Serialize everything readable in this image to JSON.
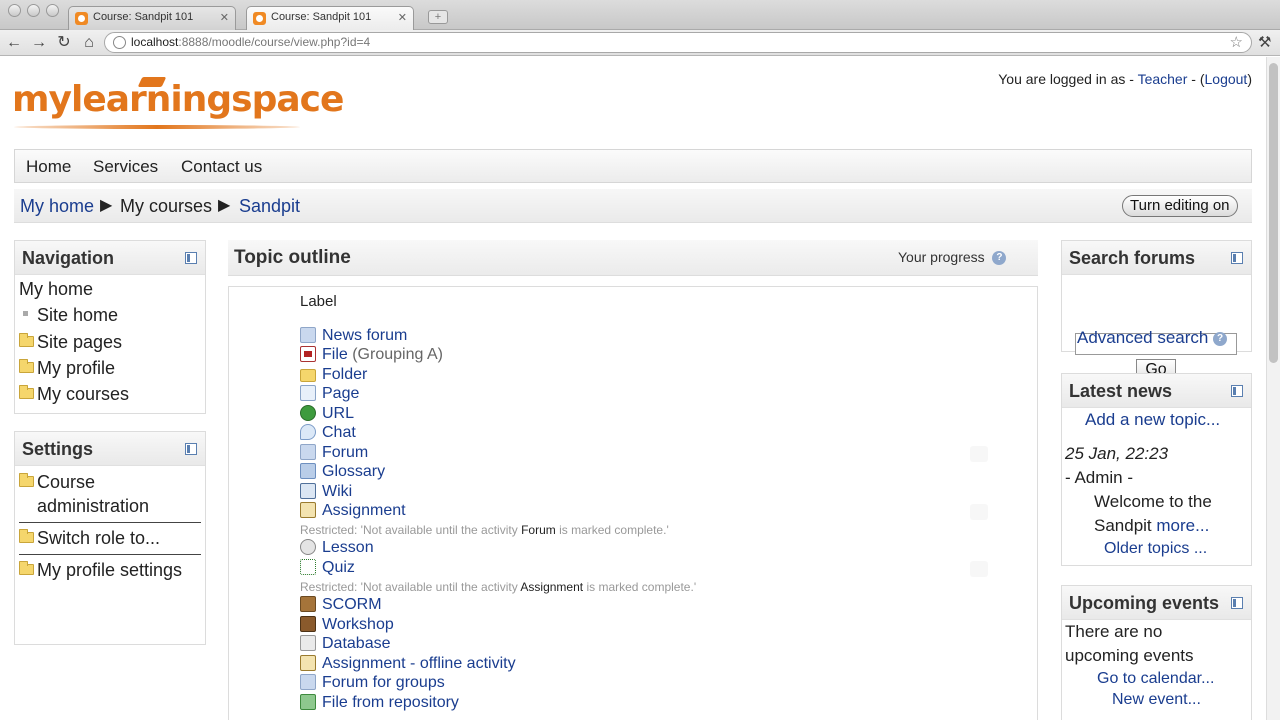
{
  "browser": {
    "tabs": [
      {
        "title": "Course: Sandpit 101",
        "active": false
      },
      {
        "title": "Course: Sandpit 101",
        "active": true
      }
    ],
    "url_host": "localhost",
    "url_path": ":8888/moodle/course/view.php?id=4"
  },
  "site": {
    "logo": "mylearningspace",
    "login": {
      "prefix": "You are logged in as - ",
      "user": "Teacher",
      "mid": " - (",
      "logout": "Logout",
      "suffix": ")"
    }
  },
  "nav": {
    "items": [
      "Home",
      "Services",
      "Contact us"
    ]
  },
  "breadcrumb": {
    "items": [
      "My home",
      "My courses",
      "Sandpit"
    ],
    "edit_button": "Turn editing on"
  },
  "navigation_block": {
    "title": "Navigation",
    "my_home": "My home",
    "items": [
      "Site home",
      "Site pages",
      "My profile",
      "My courses"
    ]
  },
  "settings_block": {
    "title": "Settings",
    "items": [
      "Course",
      "administration",
      "Switch role to...",
      "My profile settings"
    ]
  },
  "main": {
    "title": "Topic outline",
    "progress_label": "Your progress",
    "label": "Label",
    "activities": [
      {
        "name": "News forum",
        "icon": "forum-icon",
        "extra": ""
      },
      {
        "name": "File",
        "icon": "pdf-file-icon",
        "extra": " (Grouping A)"
      },
      {
        "name": "Folder",
        "icon": "folder-icon",
        "extra": ""
      },
      {
        "name": "Page",
        "icon": "page-icon",
        "extra": ""
      },
      {
        "name": "URL",
        "icon": "url-globe-icon",
        "extra": ""
      },
      {
        "name": "Chat",
        "icon": "chat-icon",
        "extra": ""
      },
      {
        "name": "Forum",
        "icon": "forum-icon",
        "extra": ""
      },
      {
        "name": "Glossary",
        "icon": "glossary-icon",
        "extra": ""
      },
      {
        "name": "Wiki",
        "icon": "wiki-icon",
        "extra": ""
      },
      {
        "name": "Assignment",
        "icon": "assignment-icon",
        "extra": ""
      },
      {
        "name": "Lesson",
        "icon": "lesson-icon",
        "extra": ""
      },
      {
        "name": "Quiz",
        "icon": "quiz-icon",
        "extra": ""
      },
      {
        "name": "SCORM",
        "icon": "scorm-icon",
        "extra": ""
      },
      {
        "name": "Workshop",
        "icon": "workshop-icon",
        "extra": ""
      },
      {
        "name": "Database",
        "icon": "database-icon",
        "extra": ""
      },
      {
        "name": "Assignment - offline activity",
        "icon": "assignment-icon",
        "extra": ""
      },
      {
        "name": "Forum for groups",
        "icon": "forum-icon",
        "extra": ""
      },
      {
        "name": "File from repository",
        "icon": "image-file-icon",
        "extra": ""
      }
    ],
    "restrictions": [
      {
        "before": "Restricted: 'Not available until the activity ",
        "activity": "Forum",
        "after": " is marked complete.'"
      },
      {
        "before": "Restricted: 'Not available until the activity ",
        "activity": "Assignment",
        "after": " is marked complete.'"
      }
    ]
  },
  "search_block": {
    "title": "Search forums",
    "go": "Go",
    "advanced": "Advanced search"
  },
  "news_block": {
    "title": "Latest news",
    "add": "Add a new topic...",
    "date": "25 Jan, 22:23",
    "author": "- Admin -",
    "line1": "Welcome to the",
    "line2": "Sandpit ",
    "more": "more...",
    "older": "Older topics ..."
  },
  "events_block": {
    "title": "Upcoming events",
    "line1": "There are no",
    "line2": "upcoming events",
    "calendar": "Go to calendar...",
    "new_event": "New event..."
  }
}
